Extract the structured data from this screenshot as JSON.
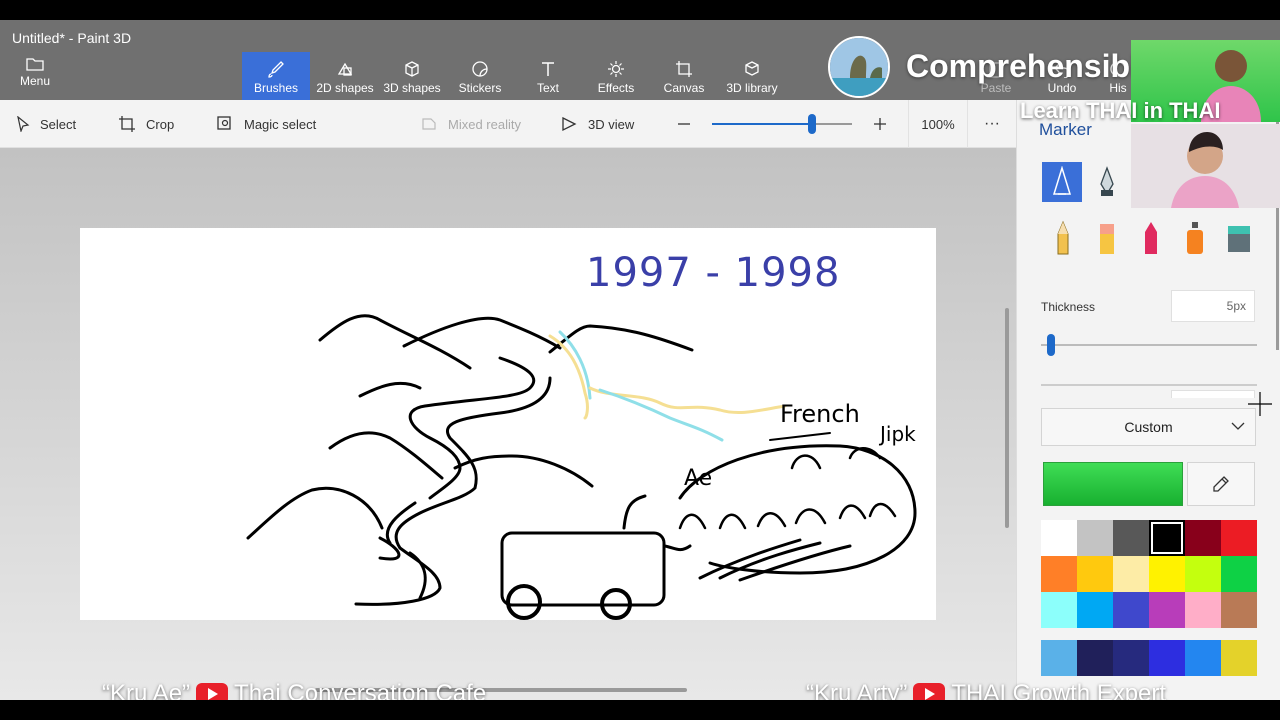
{
  "window": {
    "title": "Untitled* - Paint 3D"
  },
  "menu": {
    "label": "Menu"
  },
  "toolbar": [
    {
      "label": "Brushes",
      "icon": "brush-icon",
      "active": true
    },
    {
      "label": "2D shapes",
      "icon": "shapes-2d-icon"
    },
    {
      "label": "3D shapes",
      "icon": "cube-icon"
    },
    {
      "label": "Stickers",
      "icon": "sticker-icon"
    },
    {
      "label": "Text",
      "icon": "text-icon"
    },
    {
      "label": "Effects",
      "icon": "sun-icon"
    },
    {
      "label": "Canvas",
      "icon": "canvas-icon"
    },
    {
      "label": "3D library",
      "icon": "library-icon"
    },
    {
      "label": "Paste",
      "icon": "paste-icon"
    },
    {
      "label": "Undo",
      "icon": "undo-icon"
    },
    {
      "label": "His",
      "icon": "history-icon"
    }
  ],
  "subbar": {
    "select": "Select",
    "crop": "Crop",
    "magic_select": "Magic select",
    "mixed_reality": "Mixed reality",
    "view_3d": "3D view",
    "zoom": "100%",
    "zoom_level": 0.5,
    "more": "···"
  },
  "panel": {
    "title": "Marker",
    "thickness_label": "Thickness",
    "thickness_value": "5px",
    "thickness_level": 0.02,
    "color_mode": "Custom",
    "selected_color": "#2fc44a",
    "palette": [
      "#ffffff",
      "#c3c3c3",
      "#585858",
      "#000000",
      "#88001b",
      "#ec1c24",
      "#ff7f27",
      "#ffc90e",
      "#fdeca6",
      "#fff200",
      "#c4ff0e",
      "#0ed145",
      "#8cfffb",
      "#00a8f3",
      "#3f48cc",
      "#b83dba",
      "#ffaec8",
      "#b97a56"
    ],
    "palette_extra": [
      "#5ab1e8",
      "#20205a",
      "#262a7e",
      "#2d2ee0",
      "#2386f0",
      "#e4d22a"
    ]
  },
  "canvas_text": {
    "years": "1997 - 1998",
    "french": "French",
    "japan": "Jipk",
    "ae": "Ae"
  },
  "overlay": {
    "title": "Comprehensible Thai",
    "subtitle": "Learn THAI in THAI",
    "left_caption": "“Kru Ae”",
    "left_channel": "Thai Conversation Cafe",
    "right_caption": "“Kru Arty”",
    "right_channel": "THAI Growth Expert"
  }
}
